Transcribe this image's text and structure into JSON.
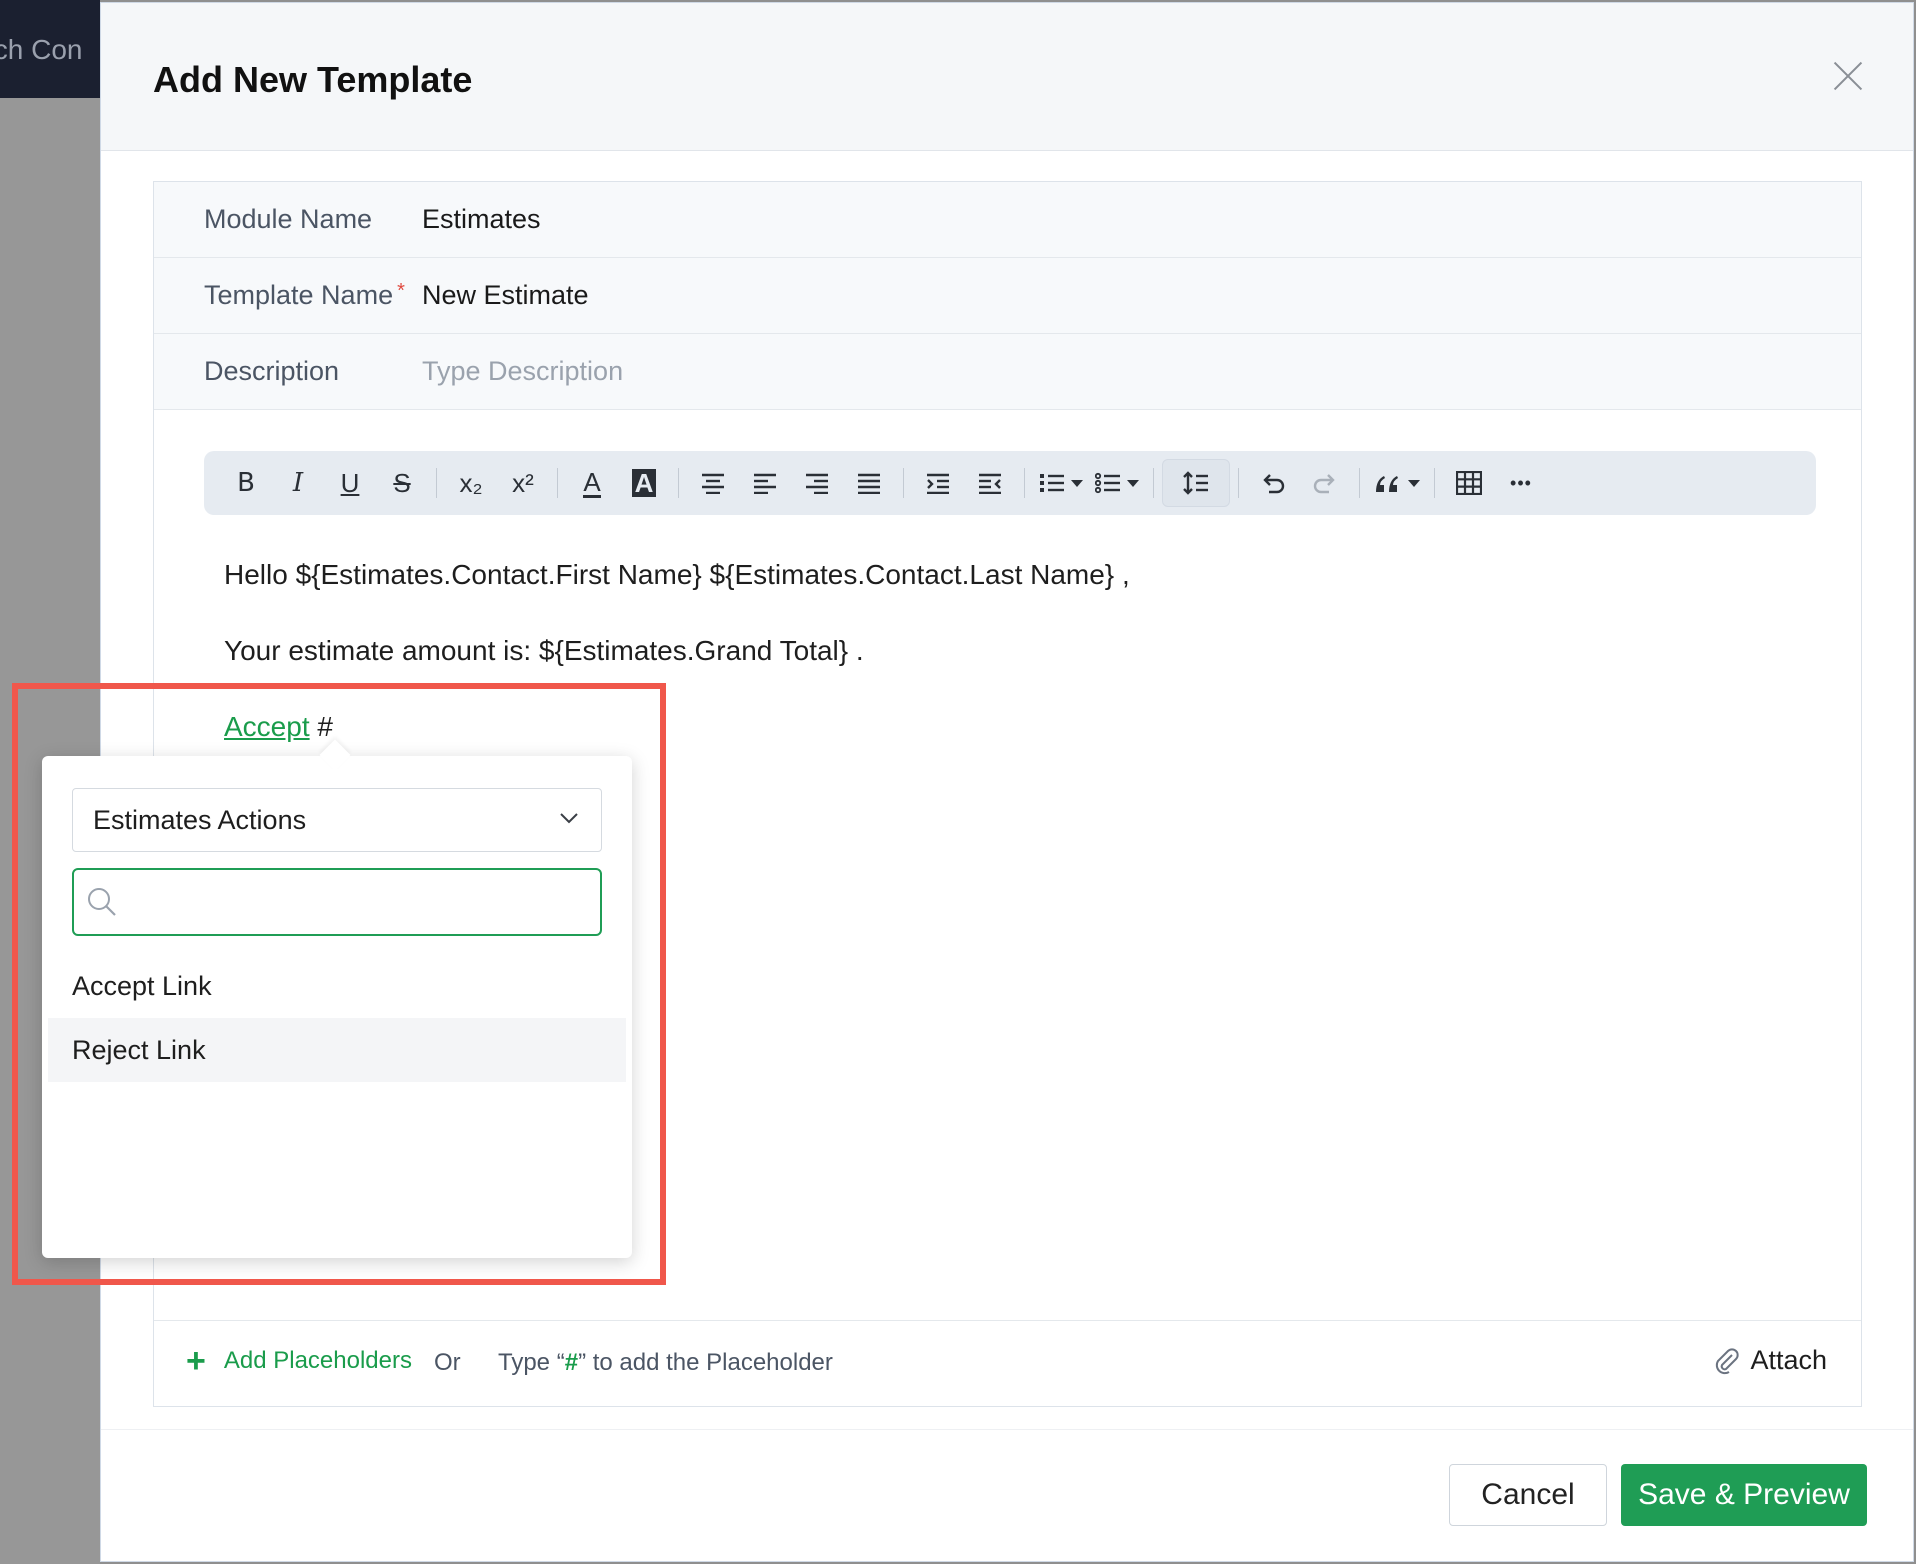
{
  "background": {
    "topbar_text": "tch Con"
  },
  "modal": {
    "title": "Add New Template",
    "close_icon": "close-icon"
  },
  "fields": {
    "module_label": "Module Name",
    "module_value": "Estimates",
    "template_label": "Template Name",
    "template_required": "*",
    "template_value": "New Estimate",
    "description_label": "Description",
    "description_placeholder": "Type Description"
  },
  "toolbar": {
    "bold": "B",
    "italic": "I",
    "underline": "U",
    "strike": "S",
    "subscript": "x₂",
    "superscript": "x²",
    "text_color": "A",
    "bg_color": "A",
    "more": "•••"
  },
  "editor": {
    "line1": "Hello ${Estimates.Contact.First Name} ${Estimates.Contact.Last Name} ,",
    "line2": "Your estimate amount is: ${Estimates.Grand Total} .",
    "link_text": "Accept",
    "hash_text": " #"
  },
  "footer": {
    "add_placeholders": "Add Placeholders",
    "or": "Or",
    "hint_pre": "Type “",
    "hint_hash": "#",
    "hint_post": "” to add the Placeholder",
    "attach": "Attach"
  },
  "buttons": {
    "cancel": "Cancel",
    "save": "Save & Preview"
  },
  "popover": {
    "select_value": "Estimates Actions",
    "search_placeholder": "",
    "options": [
      "Accept Link",
      "Reject Link"
    ]
  },
  "colors": {
    "accent_green": "#1f9d55",
    "highlight_red": "#f0574b"
  }
}
